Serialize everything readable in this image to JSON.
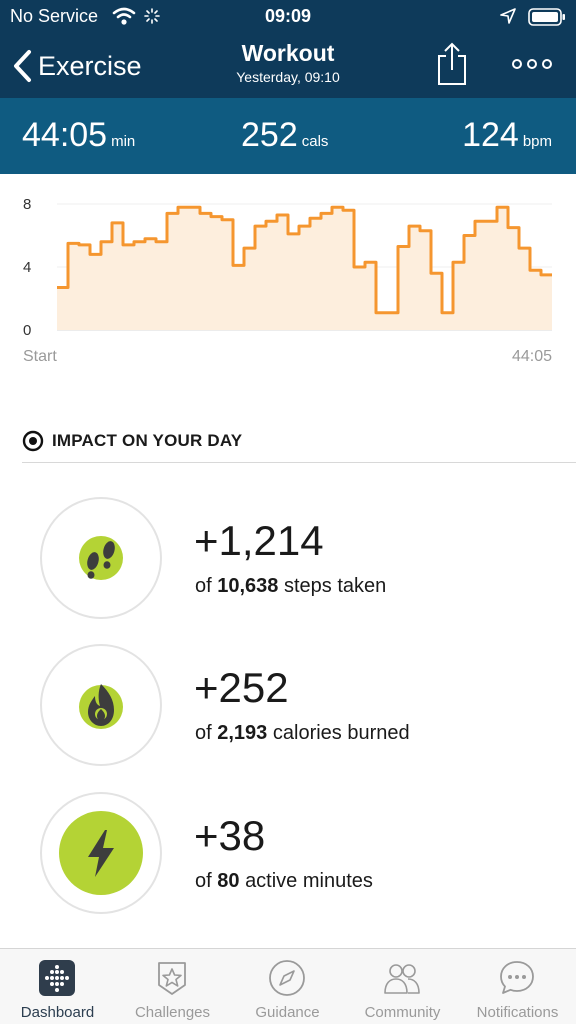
{
  "status_bar": {
    "carrier": "No Service",
    "time": "09:09"
  },
  "header": {
    "back_label": "Exercise",
    "title": "Workout",
    "subtitle": "Yesterday, 09:10"
  },
  "summary": {
    "duration_value": "44:05",
    "duration_unit": "min",
    "calories_value": "252",
    "calories_unit": "cals",
    "heart_rate_value": "124",
    "heart_rate_unit": "bpm"
  },
  "chart_data": {
    "type": "area",
    "step": true,
    "color": "#f5962f",
    "fill": "#fdeedd",
    "title": "",
    "xlabel": "",
    "ylabel": "",
    "ylim": [
      0,
      8
    ],
    "yticks": [
      "0",
      "4",
      "8"
    ],
    "x_start_label": "Start",
    "x_end_label": "44:05",
    "x_range_minutes": [
      0,
      44.08
    ],
    "values": [
      2.7,
      5.5,
      5.4,
      4.8,
      5.6,
      6.8,
      5.4,
      5.6,
      5.8,
      5.6,
      7.4,
      7.8,
      7.8,
      7.4,
      7.2,
      7.0,
      4.1,
      5.2,
      6.6,
      6.9,
      7.3,
      6.1,
      6.6,
      7.1,
      7.4,
      7.8,
      7.6,
      4.0,
      4.3,
      1.1,
      1.1,
      5.3,
      6.6,
      6.3,
      3.6,
      1.1,
      4.3,
      6.0,
      6.9,
      6.9,
      7.8,
      6.5,
      5.2,
      3.8,
      3.5
    ]
  },
  "impact": {
    "heading": "IMPACT ON YOUR DAY",
    "items": [
      {
        "delta": "+1,214",
        "prefix": "of",
        "total": "10,638",
        "suffix": "steps taken",
        "icon": "footsteps-icon"
      },
      {
        "delta": "+252",
        "prefix": "of",
        "total": "2,193",
        "suffix": "calories burned",
        "icon": "flame-icon"
      },
      {
        "delta": "+38",
        "prefix": "of",
        "total": "80",
        "suffix": "active minutes",
        "icon": "lightning-icon"
      }
    ]
  },
  "colors": {
    "header_bg": "#0e3a5a",
    "stats_bg": "#0f5b81",
    "accent_green": "#b4d335",
    "chart_line": "#f5962f"
  },
  "tabs": [
    {
      "label": "Dashboard",
      "icon": "dashboard-icon",
      "active": true
    },
    {
      "label": "Challenges",
      "icon": "challenges-star-icon",
      "active": false
    },
    {
      "label": "Guidance",
      "icon": "compass-icon",
      "active": false
    },
    {
      "label": "Community",
      "icon": "people-icon",
      "active": false
    },
    {
      "label": "Notifications",
      "icon": "chat-bubble-icon",
      "active": false
    }
  ]
}
